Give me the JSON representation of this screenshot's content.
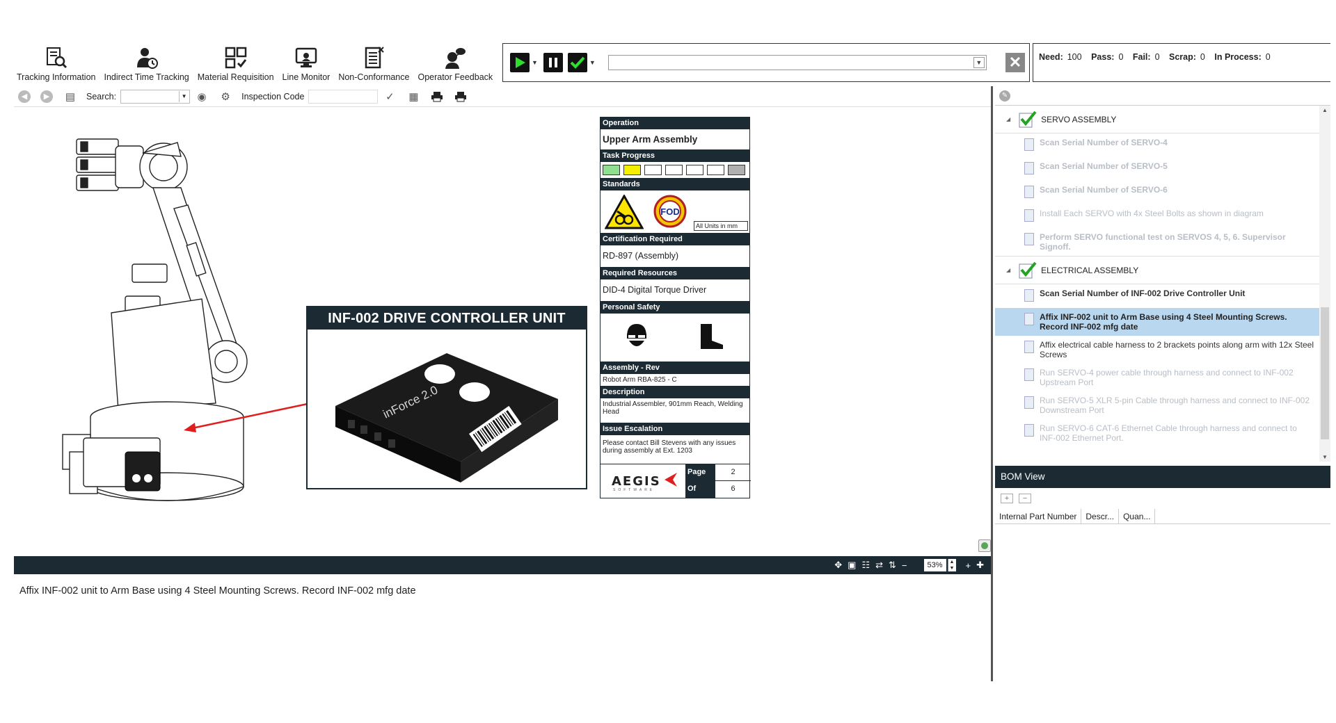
{
  "toolbar": {
    "items": [
      {
        "label": "Tracking Information",
        "icon": "tracking-info-icon"
      },
      {
        "label": "Indirect Time Tracking",
        "icon": "time-tracking-icon"
      },
      {
        "label": "Material Requisition",
        "icon": "material-requisition-icon"
      },
      {
        "label": "Line Monitor",
        "icon": "line-monitor-icon"
      },
      {
        "label": "Non-Conformance",
        "icon": "non-conformance-icon"
      },
      {
        "label": "Operator Feedback",
        "icon": "operator-feedback-icon"
      }
    ]
  },
  "counts": {
    "need_label": "Need:",
    "need": "100",
    "pass_label": "Pass:",
    "pass": "0",
    "fail_label": "Fail:",
    "fail": "0",
    "scrap_label": "Scrap:",
    "scrap": "0",
    "in_process_label": "In Process:",
    "in_process": "0"
  },
  "secondary": {
    "search_label": "Search:",
    "inspection_label": "Inspection Code"
  },
  "callout": {
    "title": "INF-002 DRIVE CONTROLLER UNIT",
    "device_brand": "inForce 2.0"
  },
  "card": {
    "operation_label": "Operation",
    "operation": "Upper Arm Assembly",
    "task_progress_label": "Task Progress",
    "task_progress_colors": [
      "#8fdf8f",
      "#f4f000",
      "#ffffff",
      "#ffffff",
      "#ffffff",
      "#ffffff",
      "#b0b0b0"
    ],
    "standards_label": "Standards",
    "units_note": "All Units in mm",
    "cert_label": "Certification Required",
    "cert": "RD-897 (Assembly)",
    "resources_label": "Required Resources",
    "resources": "DID-4 Digital Torque Driver",
    "safety_label": "Personal Safety",
    "assembly_label": "Assembly - Rev",
    "assembly": "Robot Arm RBA-825 - C",
    "description_label": "Description",
    "description": "Industrial Assembler, 901mm Reach, Welding Head",
    "escalation_label": "Issue Escalation",
    "escalation": "Please contact Bill Stevens with any issues during assembly at Ext. 1203",
    "logo": "AEGIS",
    "logo_sub": "SOFTWARE",
    "page_label": "Page",
    "page": "2",
    "of_label": "Of",
    "of": "6"
  },
  "viewer": {
    "zoom": "53%"
  },
  "instruction": "Affix INF-002 unit to Arm Base using 4 Steel Mounting Screws. Record INF-002 mfg date",
  "tasks": {
    "group1": {
      "title": "SERVO ASSEMBLY",
      "items": [
        "Scan Serial Number of SERVO-4",
        "Scan Serial Number of SERVO-5",
        "Scan Serial Number of SERVO-6",
        "Install Each SERVO with 4x Steel Bolts as shown in diagram",
        "Perform SERVO functional test on SERVOS 4, 5, 6. Supervisor Signoff."
      ]
    },
    "group2": {
      "title": "ELECTRICAL ASSEMBLY",
      "items": [
        "Scan Serial Number of INF-002 Drive Controller Unit",
        "Affix INF-002 unit to Arm Base using 4 Steel Mounting Screws. Record INF-002 mfg date",
        "Affix electrical cable harness to 2 brackets points along arm with 12x Steel Screws",
        "Run SERVO-4 power cable through harness and connect to INF-002 Upstream Port",
        "Run SERVO-5 XLR 5-pin Cable through harness and connect to INF-002 Downstream Port",
        "Run SERVO-6 CAT-6 Ethernet Cable through harness and connect to INF-002 Ethernet Port."
      ]
    }
  },
  "bom": {
    "title": "BOM View",
    "columns": [
      "Internal Part Number",
      "Descr...",
      "Quan..."
    ]
  }
}
